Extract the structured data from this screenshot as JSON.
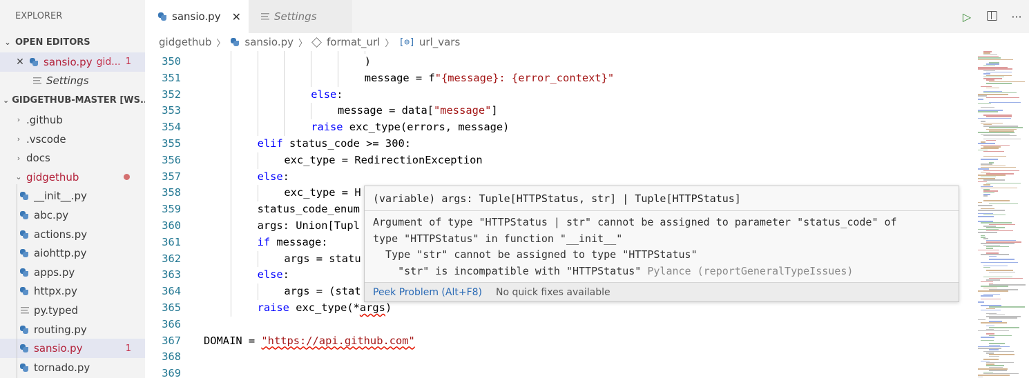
{
  "explorer": {
    "title": "EXPLORER",
    "open_editors_label": "OPEN EDITORS",
    "open_editors": [
      {
        "label": "sansio.py",
        "sub": "gid...",
        "count": "1"
      },
      {
        "label": "Settings"
      }
    ],
    "workspace_label": "GIDGETHUB-MASTER [WS...",
    "tree": [
      {
        "label": ".github",
        "kind": "folder"
      },
      {
        "label": ".vscode",
        "kind": "folder"
      },
      {
        "label": "docs",
        "kind": "folder"
      },
      {
        "label": "gidgethub",
        "kind": "folder-open"
      },
      {
        "label": "__init__.py",
        "kind": "py"
      },
      {
        "label": "abc.py",
        "kind": "py"
      },
      {
        "label": "actions.py",
        "kind": "py"
      },
      {
        "label": "aiohttp.py",
        "kind": "py"
      },
      {
        "label": "apps.py",
        "kind": "py"
      },
      {
        "label": "httpx.py",
        "kind": "py"
      },
      {
        "label": "py.typed",
        "kind": "text"
      },
      {
        "label": "routing.py",
        "kind": "py"
      },
      {
        "label": "sansio.py",
        "kind": "py",
        "count": "1"
      },
      {
        "label": "tornado.py",
        "kind": "py"
      }
    ]
  },
  "tabs": [
    {
      "label": "sansio.py",
      "close": "✕"
    },
    {
      "label": "Settings"
    }
  ],
  "toolbar": {
    "run": "▷",
    "more": "···"
  },
  "breadcrumb": [
    "gidgethub",
    "sansio.py",
    "format_url",
    "url_vars"
  ],
  "editor": {
    "lines": [
      {
        "n": "350",
        "indent": 6,
        "parts": [
          {
            "t": ")",
            "c": ""
          }
        ]
      },
      {
        "n": "351",
        "indent": 6,
        "parts": [
          {
            "t": "message = f",
            "c": ""
          },
          {
            "t": "\"{message}: {error_context}\"",
            "c": "str"
          }
        ]
      },
      {
        "n": "352",
        "indent": 4,
        "parts": [
          {
            "t": "else",
            "c": "kw"
          },
          {
            "t": ":",
            "c": ""
          }
        ]
      },
      {
        "n": "353",
        "indent": 5,
        "parts": [
          {
            "t": "message = data[",
            "c": ""
          },
          {
            "t": "\"message\"",
            "c": "str"
          },
          {
            "t": "]",
            "c": ""
          }
        ]
      },
      {
        "n": "354",
        "indent": 4,
        "parts": [
          {
            "t": "raise",
            "c": "kw"
          },
          {
            "t": " exc_type(errors, message)",
            "c": ""
          }
        ]
      },
      {
        "n": "355",
        "indent": 2,
        "parts": [
          {
            "t": "elif",
            "c": "kw"
          },
          {
            "t": " status_code >= 300:",
            "c": ""
          }
        ]
      },
      {
        "n": "356",
        "indent": 3,
        "parts": [
          {
            "t": "exc_type = RedirectionException",
            "c": ""
          }
        ]
      },
      {
        "n": "357",
        "indent": 2,
        "parts": [
          {
            "t": "else",
            "c": "kw"
          },
          {
            "t": ":",
            "c": ""
          }
        ]
      },
      {
        "n": "358",
        "indent": 3,
        "parts": [
          {
            "t": "exc_type = H",
            "c": ""
          }
        ]
      },
      {
        "n": "359",
        "indent": 2,
        "parts": [
          {
            "t": "status_code_enum",
            "c": ""
          }
        ]
      },
      {
        "n": "360",
        "indent": 2,
        "parts": [
          {
            "t": "args: Union[Tupl",
            "c": ""
          }
        ]
      },
      {
        "n": "361",
        "indent": 2,
        "parts": [
          {
            "t": "if",
            "c": "kw"
          },
          {
            "t": " message:",
            "c": ""
          }
        ]
      },
      {
        "n": "362",
        "indent": 3,
        "parts": [
          {
            "t": "args = statu",
            "c": ""
          }
        ]
      },
      {
        "n": "363",
        "indent": 2,
        "parts": [
          {
            "t": "else",
            "c": "kw"
          },
          {
            "t": ":",
            "c": ""
          }
        ]
      },
      {
        "n": "364",
        "indent": 3,
        "parts": [
          {
            "t": "args = (stat",
            "c": ""
          }
        ]
      },
      {
        "n": "365",
        "indent": 2,
        "parts": [
          {
            "t": "raise",
            "c": "kw"
          },
          {
            "t": " exc_type(*",
            "c": ""
          },
          {
            "t": "args",
            "c": "squig"
          },
          {
            "t": ")",
            "c": ""
          }
        ]
      },
      {
        "n": "366",
        "indent": 0,
        "parts": []
      },
      {
        "n": "367",
        "indent": 0,
        "parts": [
          {
            "t": "DOMAIN = ",
            "c": ""
          },
          {
            "t": "\"https://api.github.com\"",
            "c": "str squig"
          }
        ]
      },
      {
        "n": "368",
        "indent": 0,
        "parts": []
      },
      {
        "n": "369",
        "indent": 0,
        "parts": []
      }
    ]
  },
  "hover": {
    "signature": "(variable) args: Tuple[HTTPStatus, str] | Tuple[HTTPStatus]",
    "message_lines": [
      "Argument of type \"HTTPStatus | str\" cannot be assigned to parameter \"status_code\" of",
      "type \"HTTPStatus\" in function \"__init__\"",
      "  Type \"str\" cannot be assigned to type \"HTTPStatus\"",
      "    \"str\" is incompatible with \"HTTPStatus\" "
    ],
    "source": "Pylance (reportGeneralTypeIssues)",
    "peek_problem": "Peek Problem (Alt+F8)",
    "no_fixes": "No quick fixes available"
  },
  "colors": {
    "error": "#b3213a",
    "keyword": "#0000ff",
    "string": "#a31515",
    "line_number": "#237893"
  }
}
